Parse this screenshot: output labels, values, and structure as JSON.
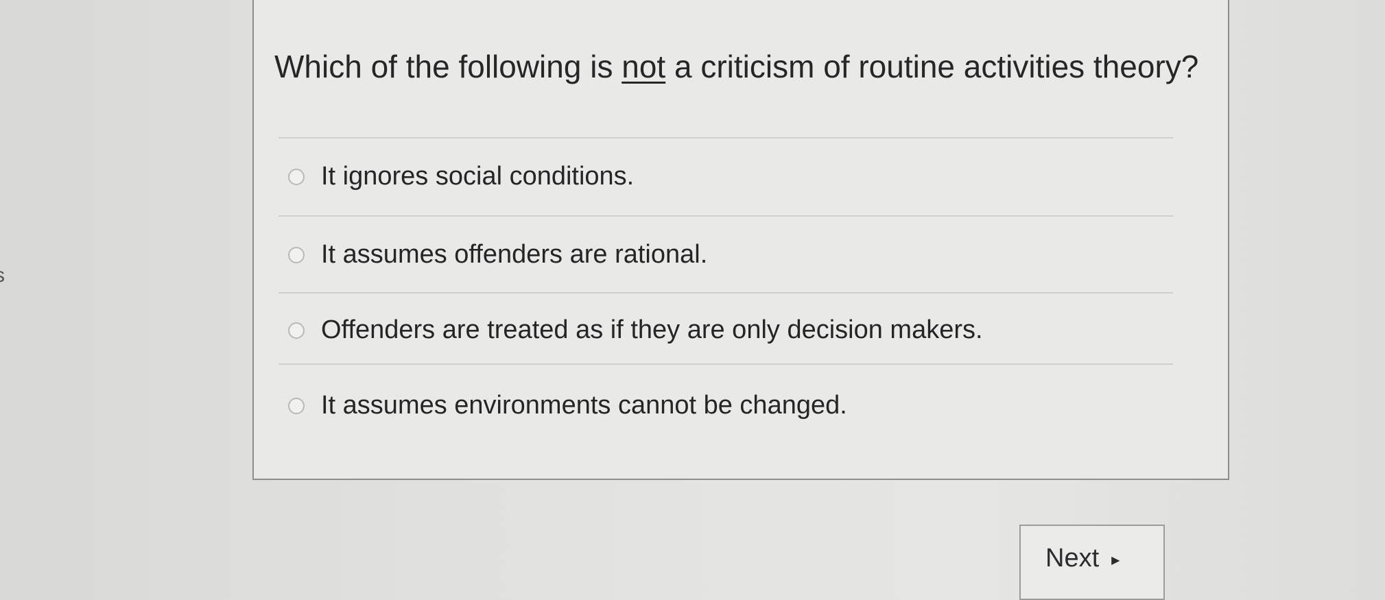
{
  "edge_glyph": "s",
  "question": {
    "before": "Which of the following is ",
    "emphasis": "not",
    "after": " a criticism of routine activities theory?"
  },
  "options": [
    {
      "label": "It ignores social conditions.",
      "selected": false
    },
    {
      "label": "It assumes offenders are rational.",
      "selected": false
    },
    {
      "label": "Offenders are treated as if they are only decision makers.",
      "selected": false
    },
    {
      "label": "It assumes environments cannot be changed.",
      "selected": false
    }
  ],
  "navigation": {
    "next_label": "Next",
    "next_icon": "triangle-right-icon"
  }
}
